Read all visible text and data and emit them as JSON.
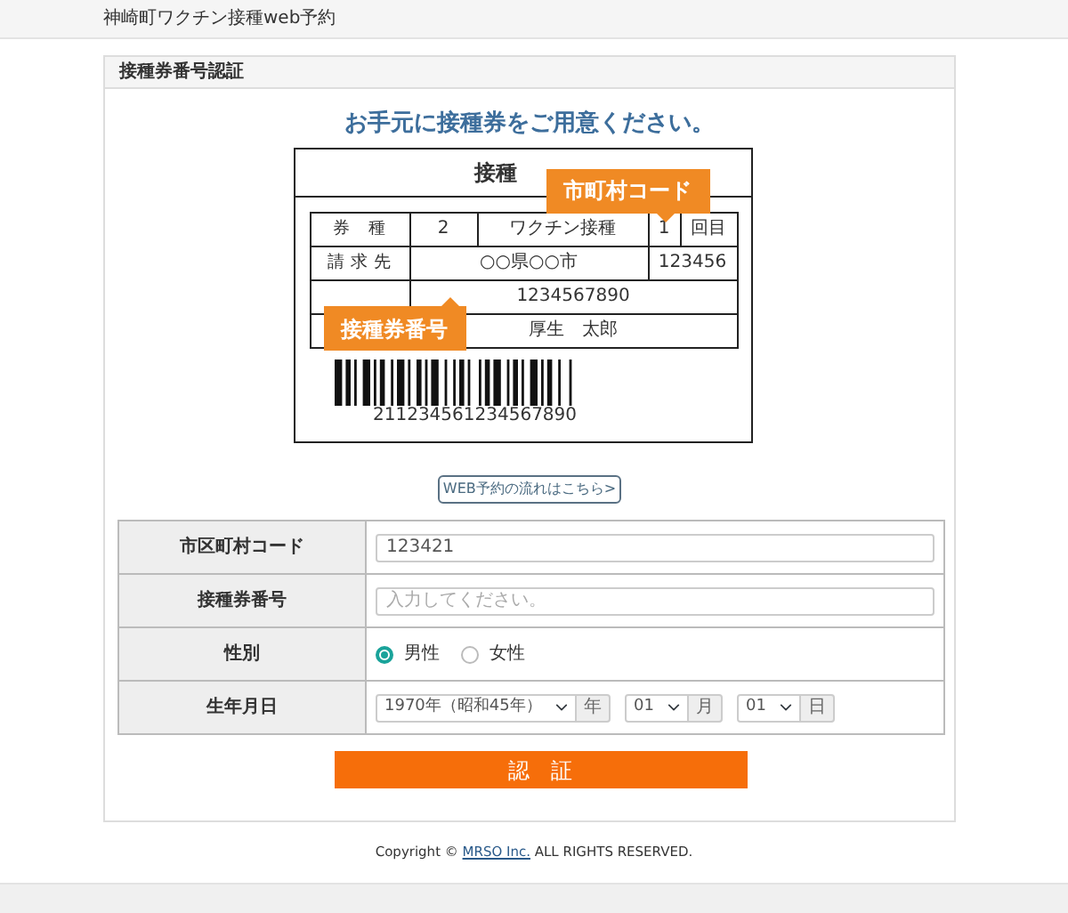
{
  "header": {
    "title": "神崎町ワクチン接種web予約"
  },
  "card": {
    "title": "接種券番号認証"
  },
  "instruction": "お手元に接種券をご用意ください。",
  "ticket": {
    "title": "接種",
    "type_label": "券　種",
    "dose_count": "2",
    "vaccine": "ワクチン接種",
    "round": "1",
    "round_unit": "回目",
    "billing_label": "請 求 先",
    "billing": "○○県○○市",
    "municipal_code": "123456",
    "number": "1234567890",
    "name": "厚生　太郎",
    "barcode_number": "211234561234567890",
    "callouts": [
      {
        "text": "市町村コード",
        "kind": "code"
      },
      {
        "text": "接種券番号",
        "kind": "number"
      }
    ]
  },
  "flow_link": "WEB予約の流れはこちら>",
  "form": [
    {
      "label": "市区町村コード",
      "kind": "text",
      "value": "123421"
    },
    {
      "label": "接種券番号",
      "kind": "text",
      "placeholder": "入力してください。"
    },
    {
      "label": "性別",
      "kind": "radio",
      "options": [
        {
          "label": "男性",
          "selected": true
        },
        {
          "label": "女性",
          "selected": false
        }
      ]
    },
    {
      "label": "生年月日",
      "kind": "date",
      "selects": [
        {
          "value": "1970年（昭和45年）",
          "unit": "年"
        },
        {
          "value": "01",
          "unit": "月"
        },
        {
          "value": "01",
          "unit": "日"
        }
      ]
    }
  ],
  "submit": "認　証",
  "footer": {
    "prefix": "Copyright © ",
    "link": "MRSO Inc.",
    "suffix": " ALL RIGHTS RESERVED."
  }
}
